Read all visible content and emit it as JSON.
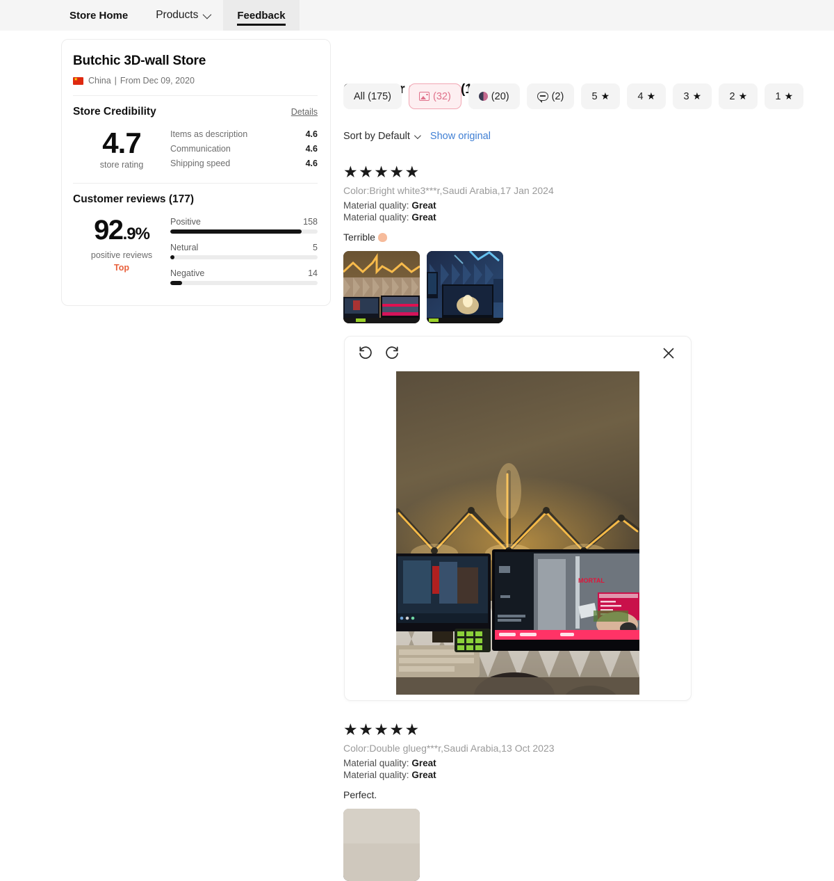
{
  "nav": {
    "items": [
      {
        "label": "Store Home",
        "active": false,
        "bold": true
      },
      {
        "label": "Products",
        "active": false,
        "bold": false,
        "caret": true
      },
      {
        "label": "Feedback",
        "active": true,
        "bold": true
      }
    ]
  },
  "store": {
    "title": "Butchic 3D-wall Store",
    "country": "China",
    "separator": "|",
    "since": "From Dec 09, 2020",
    "credibility": {
      "heading": "Store Credibility",
      "details_label": "Details",
      "score": "4.7",
      "score_label": "store rating",
      "metrics": [
        {
          "name": "Items as description",
          "value": "4.6"
        },
        {
          "name": "Communication",
          "value": "4.6"
        },
        {
          "name": "Shipping speed",
          "value": "4.6"
        }
      ]
    },
    "reviews_summary": {
      "heading": "Customer reviews (177)",
      "percent_main": "92",
      "percent_small": ".9%",
      "percent_label": "positive reviews",
      "top_badge": "Top",
      "bars": [
        {
          "label": "Positive",
          "count": "158",
          "pct": 89
        },
        {
          "label": "Netural",
          "count": "5",
          "pct": 3
        },
        {
          "label": "Negative",
          "count": "14",
          "pct": 8
        }
      ]
    }
  },
  "reviews_panel": {
    "title": "Customer reviews (177)",
    "filters": [
      {
        "label": "All (175)",
        "icon": "none",
        "selected": false
      },
      {
        "label": "(32)",
        "icon": "image-icon",
        "selected": true
      },
      {
        "label": "(20)",
        "icon": "video-icon",
        "selected": false
      },
      {
        "label": "(2)",
        "icon": "comment-bubble-icon",
        "selected": false
      },
      {
        "label": "5",
        "icon": "star-icon",
        "selected": false
      },
      {
        "label": "4",
        "icon": "star-icon",
        "selected": false
      },
      {
        "label": "3",
        "icon": "star-icon",
        "selected": false
      },
      {
        "label": "2",
        "icon": "star-icon",
        "selected": false
      },
      {
        "label": "1",
        "icon": "star-icon",
        "selected": false
      }
    ],
    "sort_label": "Sort by Default",
    "show_original_label": "Show original",
    "reviews": [
      {
        "stars": "★★★★★",
        "meta": "Color:Bright white3***r,Saudi Arabia,17 Jan 2024",
        "attributes": [
          {
            "name": "Material quality:",
            "value": "Great"
          },
          {
            "name": "Material quality:",
            "value": "Great"
          }
        ],
        "text": "Terrible",
        "emoji": "hand-emoji",
        "thumb_count": 2
      },
      {
        "stars": "★★★★★",
        "meta": "Color:Double glueg***r,Saudi Arabia,13 Oct 2023",
        "attributes": [
          {
            "name": "Material quality:",
            "value": "Great"
          },
          {
            "name": "Material quality:",
            "value": "Great"
          }
        ],
        "text": "Perfect.",
        "emoji": "",
        "thumb_count": 1
      }
    ]
  },
  "lightbox": {
    "rotate_left_label": "rotate-left",
    "rotate_right_label": "rotate-right",
    "close_label": "close"
  },
  "colors": {
    "accent_pink": "#e0718a",
    "accent_pink_bg": "#fdeff1",
    "link_blue": "#3f7fd4",
    "top_orange": "#e8603c",
    "bar_fill": "#141414",
    "chip_bg": "#f4f4f4",
    "nav_bg": "#f5f5f5",
    "nav_active_bg": "#ebebeb"
  }
}
